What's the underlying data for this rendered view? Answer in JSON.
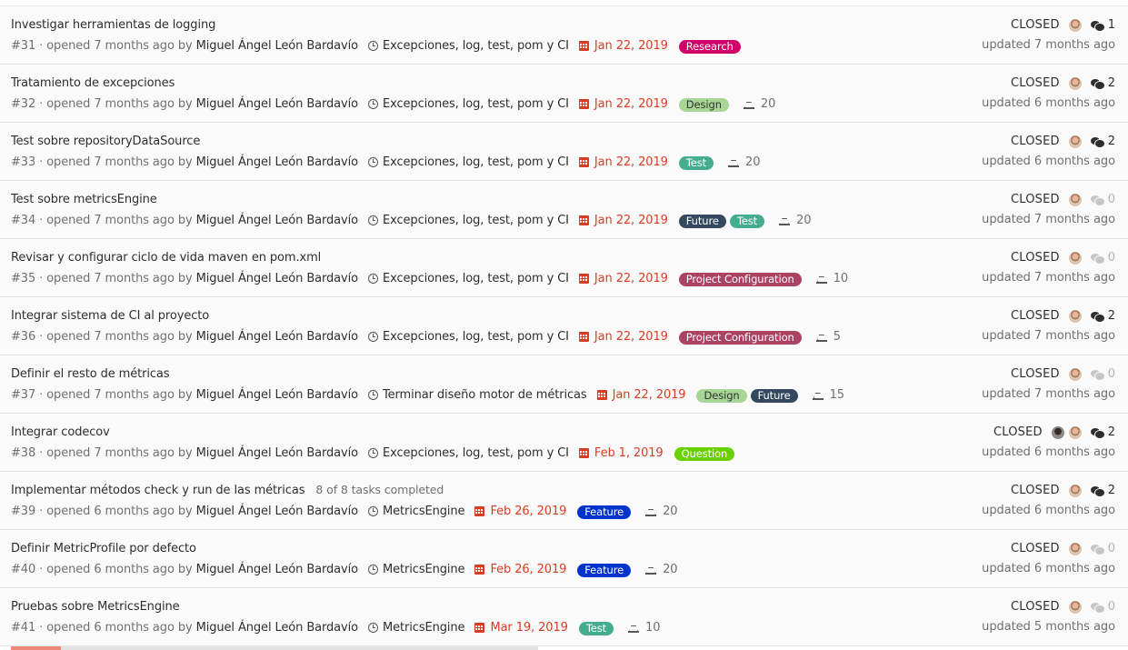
{
  "issues": [
    {
      "title": "Investigar herramientas de logging",
      "tasks": "",
      "ref": "#31",
      "opened": "· opened 7 months ago by",
      "author": "Miguel Ángel León Bardavío",
      "milestone": "Excepciones, log, test, pom y CI",
      "due": "Jan 22, 2019",
      "labels": [
        {
          "text": "Research",
          "color": "#d10069"
        }
      ],
      "weight": "",
      "state": "CLOSED",
      "comments": "1",
      "updated": "updated 7 months ago"
    },
    {
      "title": "Tratamiento de excepciones",
      "tasks": "",
      "ref": "#32",
      "opened": "· opened 7 months ago by",
      "author": "Miguel Ángel León Bardavío",
      "milestone": "Excepciones, log, test, pom y CI",
      "due": "Jan 22, 2019",
      "labels": [
        {
          "text": "Design",
          "color": "#a8d695",
          "dark": true
        }
      ],
      "weight": "20",
      "state": "CLOSED",
      "comments": "2",
      "updated": "updated 6 months ago"
    },
    {
      "title": "Test sobre repositoryDataSource",
      "tasks": "",
      "ref": "#33",
      "opened": "· opened 7 months ago by",
      "author": "Miguel Ángel León Bardavío",
      "milestone": "Excepciones, log, test, pom y CI",
      "due": "Jan 22, 2019",
      "labels": [
        {
          "text": "Test",
          "color": "#44ad8e"
        }
      ],
      "weight": "20",
      "state": "CLOSED",
      "comments": "2",
      "updated": "updated 6 months ago"
    },
    {
      "title": "Test sobre metricsEngine",
      "tasks": "",
      "ref": "#34",
      "opened": "· opened 7 months ago by",
      "author": "Miguel Ángel León Bardavío",
      "milestone": "Excepciones, log, test, pom y CI",
      "due": "Jan 22, 2019",
      "labels": [
        {
          "text": "Future",
          "color": "#34495e"
        },
        {
          "text": "Test",
          "color": "#44ad8e"
        }
      ],
      "weight": "20",
      "state": "CLOSED",
      "comments": "0",
      "updated": "updated 7 months ago"
    },
    {
      "title": "Revisar y configurar ciclo de vida maven en pom.xml",
      "tasks": "",
      "ref": "#35",
      "opened": "· opened 7 months ago by",
      "author": "Miguel Ángel León Bardavío",
      "milestone": "Excepciones, log, test, pom y CI",
      "due": "Jan 22, 2019",
      "labels": [
        {
          "text": "Project Configuration",
          "color": "#ad4363"
        }
      ],
      "weight": "10",
      "state": "CLOSED",
      "comments": "0",
      "updated": "updated 7 months ago"
    },
    {
      "title": "Integrar sistema de CI al proyecto",
      "tasks": "",
      "ref": "#36",
      "opened": "· opened 7 months ago by",
      "author": "Miguel Ángel León Bardavío",
      "milestone": "Excepciones, log, test, pom y CI",
      "due": "Jan 22, 2019",
      "labels": [
        {
          "text": "Project Configuration",
          "color": "#ad4363"
        }
      ],
      "weight": "5",
      "state": "CLOSED",
      "comments": "2",
      "updated": "updated 7 months ago"
    },
    {
      "title": "Definir el resto de métricas",
      "tasks": "",
      "ref": "#37",
      "opened": "· opened 7 months ago by",
      "author": "Miguel Ángel León Bardavío",
      "milestone": "Terminar diseño motor de métricas",
      "due": "Jan 22, 2019",
      "labels": [
        {
          "text": "Design",
          "color": "#a8d695",
          "dark": true
        },
        {
          "text": "Future",
          "color": "#34495e"
        }
      ],
      "weight": "15",
      "state": "CLOSED",
      "comments": "0",
      "updated": "updated 7 months ago"
    },
    {
      "title": "Integrar codecov",
      "tasks": "",
      "ref": "#38",
      "opened": "· opened 7 months ago by",
      "author": "Miguel Ángel León Bardavío",
      "milestone": "Excepciones, log, test, pom y CI",
      "due": "Feb 1, 2019",
      "labels": [
        {
          "text": "Question",
          "color": "#69d100"
        }
      ],
      "weight": "",
      "state": "CLOSED",
      "comments": "2",
      "two_avatars": true,
      "updated": "updated 6 months ago"
    },
    {
      "title": "Implementar métodos check y run de las métricas",
      "tasks": "8 of 8 tasks completed",
      "ref": "#39",
      "opened": "· opened 6 months ago by",
      "author": "Miguel Ángel León Bardavío",
      "milestone": "MetricsEngine",
      "due": "Feb 26, 2019",
      "labels": [
        {
          "text": "Feature",
          "color": "#0033cc"
        }
      ],
      "weight": "20",
      "state": "CLOSED",
      "comments": "2",
      "updated": "updated 6 months ago"
    },
    {
      "title": "Definir MetricProfile por defecto",
      "tasks": "",
      "ref": "#40",
      "opened": "· opened 6 months ago by",
      "author": "Miguel Ángel León Bardavío",
      "milestone": "MetricsEngine",
      "due": "Feb 26, 2019",
      "labels": [
        {
          "text": "Feature",
          "color": "#0033cc"
        }
      ],
      "weight": "20",
      "state": "CLOSED",
      "comments": "0",
      "updated": "updated 6 months ago"
    },
    {
      "title": "Pruebas sobre MetricsEngine",
      "tasks": "",
      "ref": "#41",
      "opened": "· opened 6 months ago by",
      "author": "Miguel Ángel León Bardavío",
      "milestone": "MetricsEngine",
      "due": "Mar 19, 2019",
      "labels": [
        {
          "text": "Test",
          "color": "#44ad8e"
        }
      ],
      "weight": "10",
      "state": "CLOSED",
      "comments": "0",
      "updated": "updated 5 months ago"
    }
  ]
}
